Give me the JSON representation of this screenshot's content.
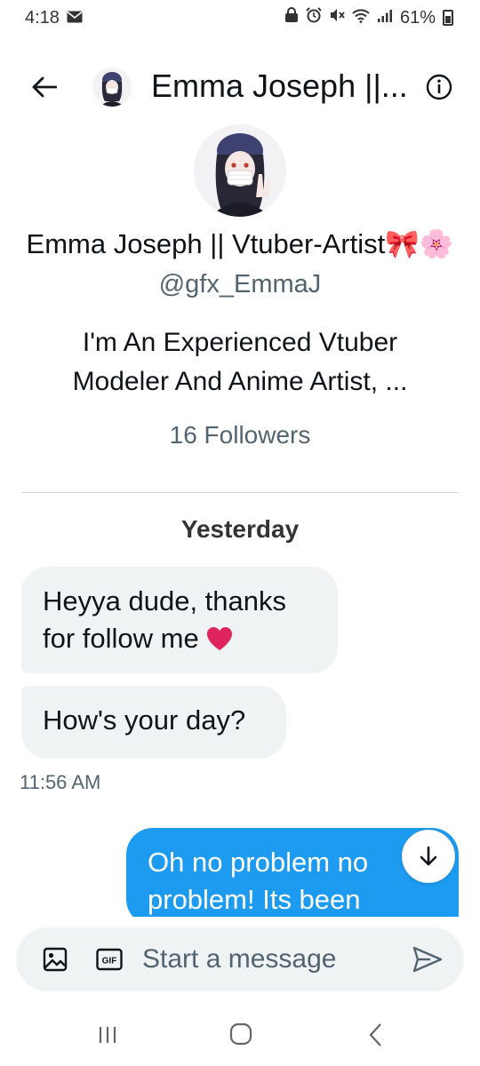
{
  "status_bar": {
    "time": "4:18",
    "battery": "61%",
    "icons": [
      "mail-icon",
      "lock-icon",
      "alarm-icon",
      "mute-icon",
      "wifi-icon",
      "signal-icon",
      "battery-icon"
    ]
  },
  "header": {
    "title": "Emma Joseph ||...",
    "icons": [
      "back-arrow-icon",
      "info-icon"
    ]
  },
  "profile": {
    "name": "Emma Joseph || Vtuber-Artist🎀🌸",
    "handle": "@gfx_EmmaJ",
    "bio": "I'm An Experienced Vtuber Modeler And Anime Artist, ...",
    "followers": "16 Followers"
  },
  "conversation": {
    "date_separator": "Yesterday",
    "messages": [
      {
        "direction": "in",
        "text": "Heyya dude, thanks for follow me"
      },
      {
        "direction": "in",
        "text": "How's your day?"
      },
      {
        "direction": "out",
        "text": "Oh no problem no problem! Its been"
      }
    ],
    "incoming_time": "11:56 AM"
  },
  "composer": {
    "placeholder": "Start a message",
    "gif_label": "GIF",
    "icons": [
      "image-icon",
      "gif-icon",
      "send-icon"
    ]
  },
  "colors": {
    "accent": "#1d9bf0",
    "bubble_in": "#eff3f4",
    "secondary_text": "#536471",
    "heart": "#e0245e"
  }
}
